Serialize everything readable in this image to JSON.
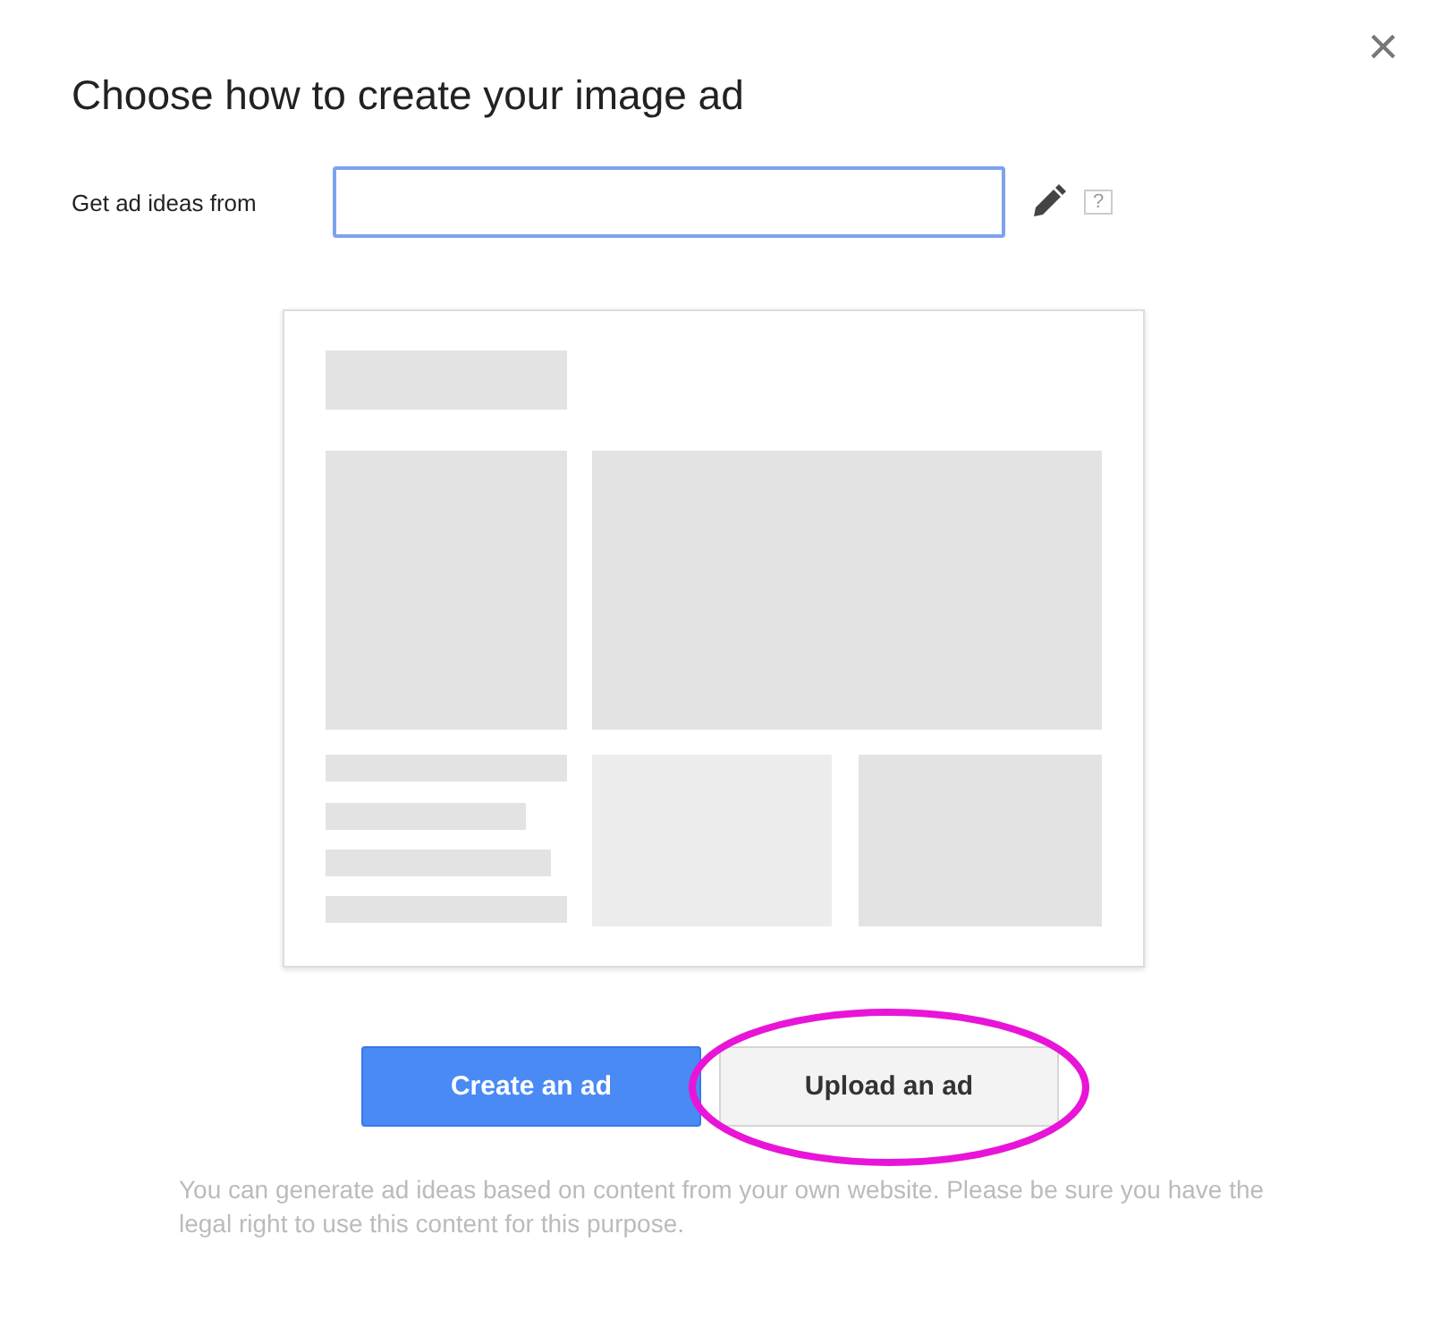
{
  "dialog": {
    "title": "Choose how to create your image ad",
    "close": "×"
  },
  "source": {
    "label": "Get ad ideas from",
    "help": "?"
  },
  "buttons": [
    {
      "label": "Create an ad",
      "kind": "primary",
      "circled": false
    },
    {
      "label": "Upload an ad",
      "kind": "secondary",
      "circled": true
    }
  ],
  "note": "You can generate ad ideas based on content from your own website. Please be sure you have the legal right to use this content for this purpose."
}
